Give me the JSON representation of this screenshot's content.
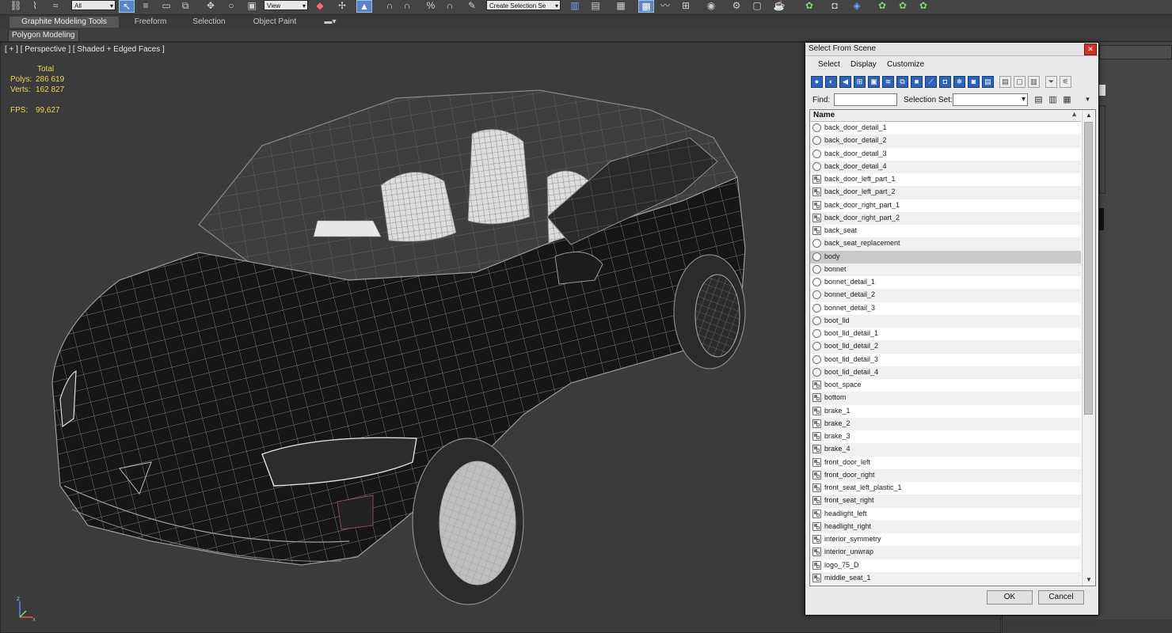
{
  "toolbar": {
    "filter_dropdown": "All",
    "view_dropdown": "View",
    "selection_set_dropdown": "Create Selection Se"
  },
  "ribbon": {
    "tabs": [
      "Graphite Modeling Tools",
      "Freeform",
      "Selection",
      "Object Paint"
    ],
    "sub_panel": "Polygon Modeling"
  },
  "viewport": {
    "label": "[ + ] [ Perspective ] [ Shaded + Edged Faces ]",
    "stats": {
      "total_label": "Total",
      "polys_label": "Polys:",
      "polys_value": "286 619",
      "verts_label": "Verts:",
      "verts_value": "162 827",
      "fps_label": "FPS:",
      "fps_value": "99,627"
    },
    "gizmo_axes": [
      "z",
      "x"
    ]
  },
  "dialog": {
    "title": "Select From Scene",
    "close_glyph": "✕",
    "menu": [
      "Select",
      "Display",
      "Customize"
    ],
    "find_label": "Find:",
    "find_value": "",
    "selection_set_label": "Selection Set:",
    "selection_set_value": "",
    "column_header": "Name",
    "items": [
      {
        "name": "back_door_detail_1",
        "kind": "object"
      },
      {
        "name": "back_door_detail_2",
        "kind": "object"
      },
      {
        "name": "back_door_detail_3",
        "kind": "object"
      },
      {
        "name": "back_door_detail_4",
        "kind": "object"
      },
      {
        "name": "back_door_left_part_1",
        "kind": "group"
      },
      {
        "name": "back_door_left_part_2",
        "kind": "group"
      },
      {
        "name": "back_door_right_part_1",
        "kind": "group"
      },
      {
        "name": "back_door_right_part_2",
        "kind": "group"
      },
      {
        "name": "back_seat",
        "kind": "group"
      },
      {
        "name": "back_seat_replacement",
        "kind": "object"
      },
      {
        "name": "body",
        "kind": "object",
        "selected": true
      },
      {
        "name": "bonnet",
        "kind": "object"
      },
      {
        "name": "bonnet_detail_1",
        "kind": "object"
      },
      {
        "name": "bonnet_detail_2",
        "kind": "object"
      },
      {
        "name": "bonnet_detail_3",
        "kind": "object"
      },
      {
        "name": "boot_lid",
        "kind": "object"
      },
      {
        "name": "boot_lid_detail_1",
        "kind": "object"
      },
      {
        "name": "boot_lid_detail_2",
        "kind": "object"
      },
      {
        "name": "boot_lid_detail_3",
        "kind": "object"
      },
      {
        "name": "boot_lid_detail_4",
        "kind": "object"
      },
      {
        "name": "boot_space",
        "kind": "group"
      },
      {
        "name": "bottom",
        "kind": "group"
      },
      {
        "name": "brake_1",
        "kind": "group"
      },
      {
        "name": "brake_2",
        "kind": "group"
      },
      {
        "name": "brake_3",
        "kind": "group"
      },
      {
        "name": "brake_4",
        "kind": "group"
      },
      {
        "name": "front_door_left",
        "kind": "group"
      },
      {
        "name": "front_door_right",
        "kind": "group"
      },
      {
        "name": "front_seat_left_plastic_1",
        "kind": "group"
      },
      {
        "name": "front_seat_right",
        "kind": "group"
      },
      {
        "name": "headlight_left",
        "kind": "group"
      },
      {
        "name": "headlight_right",
        "kind": "group"
      },
      {
        "name": "interior_symmetry",
        "kind": "group"
      },
      {
        "name": "interior_unwrap",
        "kind": "group"
      },
      {
        "name": "logo_75_D",
        "kind": "group"
      },
      {
        "name": "middle_seat_1",
        "kind": "group"
      }
    ],
    "ok_label": "OK",
    "cancel_label": "Cancel"
  }
}
